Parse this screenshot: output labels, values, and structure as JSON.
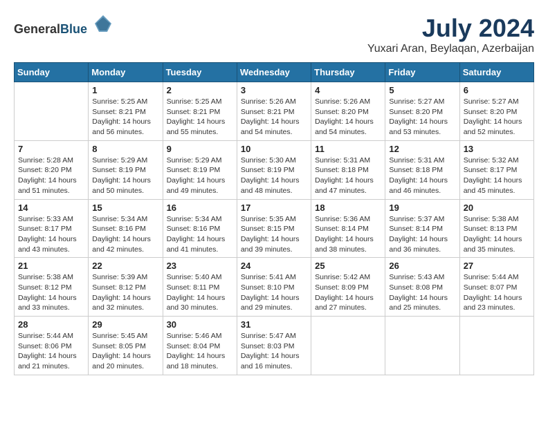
{
  "header": {
    "logo_general": "General",
    "logo_blue": "Blue",
    "month_year": "July 2024",
    "location": "Yuxari Aran, Beylaqan, Azerbaijan"
  },
  "weekdays": [
    "Sunday",
    "Monday",
    "Tuesday",
    "Wednesday",
    "Thursday",
    "Friday",
    "Saturday"
  ],
  "weeks": [
    [
      {
        "day": "",
        "sunrise": "",
        "sunset": "",
        "daylight": ""
      },
      {
        "day": "1",
        "sunrise": "Sunrise: 5:25 AM",
        "sunset": "Sunset: 8:21 PM",
        "daylight": "Daylight: 14 hours and 56 minutes."
      },
      {
        "day": "2",
        "sunrise": "Sunrise: 5:25 AM",
        "sunset": "Sunset: 8:21 PM",
        "daylight": "Daylight: 14 hours and 55 minutes."
      },
      {
        "day": "3",
        "sunrise": "Sunrise: 5:26 AM",
        "sunset": "Sunset: 8:21 PM",
        "daylight": "Daylight: 14 hours and 54 minutes."
      },
      {
        "day": "4",
        "sunrise": "Sunrise: 5:26 AM",
        "sunset": "Sunset: 8:20 PM",
        "daylight": "Daylight: 14 hours and 54 minutes."
      },
      {
        "day": "5",
        "sunrise": "Sunrise: 5:27 AM",
        "sunset": "Sunset: 8:20 PM",
        "daylight": "Daylight: 14 hours and 53 minutes."
      },
      {
        "day": "6",
        "sunrise": "Sunrise: 5:27 AM",
        "sunset": "Sunset: 8:20 PM",
        "daylight": "Daylight: 14 hours and 52 minutes."
      }
    ],
    [
      {
        "day": "7",
        "sunrise": "Sunrise: 5:28 AM",
        "sunset": "Sunset: 8:20 PM",
        "daylight": "Daylight: 14 hours and 51 minutes."
      },
      {
        "day": "8",
        "sunrise": "Sunrise: 5:29 AM",
        "sunset": "Sunset: 8:19 PM",
        "daylight": "Daylight: 14 hours and 50 minutes."
      },
      {
        "day": "9",
        "sunrise": "Sunrise: 5:29 AM",
        "sunset": "Sunset: 8:19 PM",
        "daylight": "Daylight: 14 hours and 49 minutes."
      },
      {
        "day": "10",
        "sunrise": "Sunrise: 5:30 AM",
        "sunset": "Sunset: 8:19 PM",
        "daylight": "Daylight: 14 hours and 48 minutes."
      },
      {
        "day": "11",
        "sunrise": "Sunrise: 5:31 AM",
        "sunset": "Sunset: 8:18 PM",
        "daylight": "Daylight: 14 hours and 47 minutes."
      },
      {
        "day": "12",
        "sunrise": "Sunrise: 5:31 AM",
        "sunset": "Sunset: 8:18 PM",
        "daylight": "Daylight: 14 hours and 46 minutes."
      },
      {
        "day": "13",
        "sunrise": "Sunrise: 5:32 AM",
        "sunset": "Sunset: 8:17 PM",
        "daylight": "Daylight: 14 hours and 45 minutes."
      }
    ],
    [
      {
        "day": "14",
        "sunrise": "Sunrise: 5:33 AM",
        "sunset": "Sunset: 8:17 PM",
        "daylight": "Daylight: 14 hours and 43 minutes."
      },
      {
        "day": "15",
        "sunrise": "Sunrise: 5:34 AM",
        "sunset": "Sunset: 8:16 PM",
        "daylight": "Daylight: 14 hours and 42 minutes."
      },
      {
        "day": "16",
        "sunrise": "Sunrise: 5:34 AM",
        "sunset": "Sunset: 8:16 PM",
        "daylight": "Daylight: 14 hours and 41 minutes."
      },
      {
        "day": "17",
        "sunrise": "Sunrise: 5:35 AM",
        "sunset": "Sunset: 8:15 PM",
        "daylight": "Daylight: 14 hours and 39 minutes."
      },
      {
        "day": "18",
        "sunrise": "Sunrise: 5:36 AM",
        "sunset": "Sunset: 8:14 PM",
        "daylight": "Daylight: 14 hours and 38 minutes."
      },
      {
        "day": "19",
        "sunrise": "Sunrise: 5:37 AM",
        "sunset": "Sunset: 8:14 PM",
        "daylight": "Daylight: 14 hours and 36 minutes."
      },
      {
        "day": "20",
        "sunrise": "Sunrise: 5:38 AM",
        "sunset": "Sunset: 8:13 PM",
        "daylight": "Daylight: 14 hours and 35 minutes."
      }
    ],
    [
      {
        "day": "21",
        "sunrise": "Sunrise: 5:38 AM",
        "sunset": "Sunset: 8:12 PM",
        "daylight": "Daylight: 14 hours and 33 minutes."
      },
      {
        "day": "22",
        "sunrise": "Sunrise: 5:39 AM",
        "sunset": "Sunset: 8:12 PM",
        "daylight": "Daylight: 14 hours and 32 minutes."
      },
      {
        "day": "23",
        "sunrise": "Sunrise: 5:40 AM",
        "sunset": "Sunset: 8:11 PM",
        "daylight": "Daylight: 14 hours and 30 minutes."
      },
      {
        "day": "24",
        "sunrise": "Sunrise: 5:41 AM",
        "sunset": "Sunset: 8:10 PM",
        "daylight": "Daylight: 14 hours and 29 minutes."
      },
      {
        "day": "25",
        "sunrise": "Sunrise: 5:42 AM",
        "sunset": "Sunset: 8:09 PM",
        "daylight": "Daylight: 14 hours and 27 minutes."
      },
      {
        "day": "26",
        "sunrise": "Sunrise: 5:43 AM",
        "sunset": "Sunset: 8:08 PM",
        "daylight": "Daylight: 14 hours and 25 minutes."
      },
      {
        "day": "27",
        "sunrise": "Sunrise: 5:44 AM",
        "sunset": "Sunset: 8:07 PM",
        "daylight": "Daylight: 14 hours and 23 minutes."
      }
    ],
    [
      {
        "day": "28",
        "sunrise": "Sunrise: 5:44 AM",
        "sunset": "Sunset: 8:06 PM",
        "daylight": "Daylight: 14 hours and 21 minutes."
      },
      {
        "day": "29",
        "sunrise": "Sunrise: 5:45 AM",
        "sunset": "Sunset: 8:05 PM",
        "daylight": "Daylight: 14 hours and 20 minutes."
      },
      {
        "day": "30",
        "sunrise": "Sunrise: 5:46 AM",
        "sunset": "Sunset: 8:04 PM",
        "daylight": "Daylight: 14 hours and 18 minutes."
      },
      {
        "day": "31",
        "sunrise": "Sunrise: 5:47 AM",
        "sunset": "Sunset: 8:03 PM",
        "daylight": "Daylight: 14 hours and 16 minutes."
      },
      {
        "day": "",
        "sunrise": "",
        "sunset": "",
        "daylight": ""
      },
      {
        "day": "",
        "sunrise": "",
        "sunset": "",
        "daylight": ""
      },
      {
        "day": "",
        "sunrise": "",
        "sunset": "",
        "daylight": ""
      }
    ]
  ]
}
